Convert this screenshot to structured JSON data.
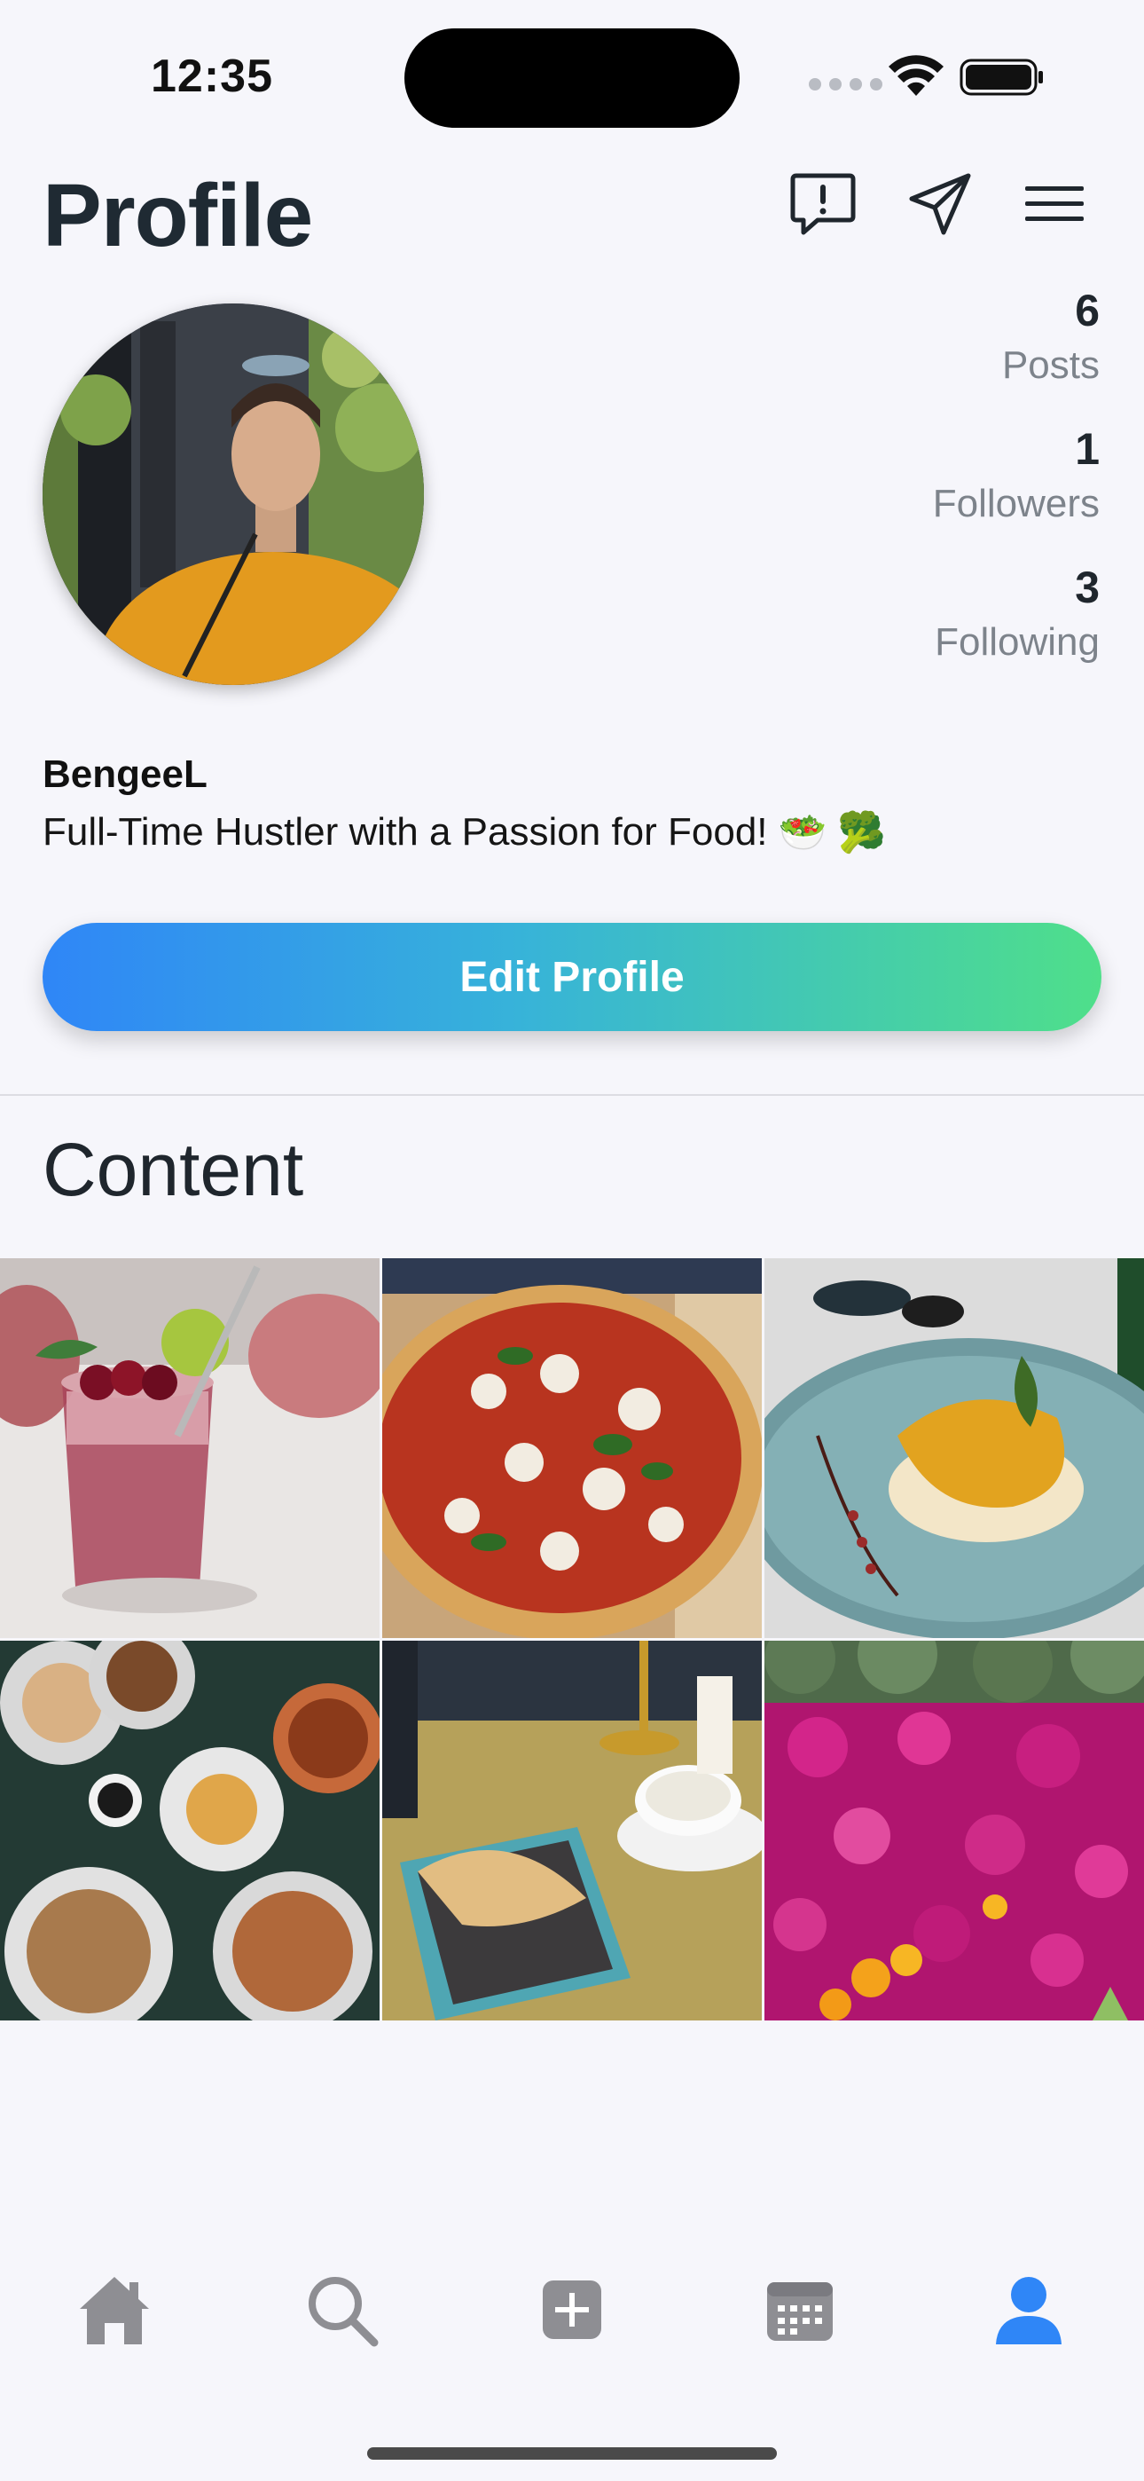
{
  "status_bar": {
    "time": "12:35"
  },
  "header": {
    "title": "Profile",
    "icons": [
      "report-icon",
      "send-icon",
      "menu-icon"
    ]
  },
  "profile": {
    "username": "BengeeL",
    "bio": "Full-Time Hustler with a Passion for Food!",
    "bio_emojis": [
      "🥗",
      "🥦"
    ],
    "stats": [
      {
        "value": "6",
        "label": "Posts"
      },
      {
        "value": "1",
        "label": "Followers"
      },
      {
        "value": "3",
        "label": "Following"
      }
    ],
    "edit_button": "Edit Profile"
  },
  "content": {
    "title": "Content",
    "posts": [
      "cocktail",
      "pizza",
      "plated-dish",
      "brunch-spread",
      "croissant-coffee",
      "pink-flowers"
    ]
  },
  "tab_bar": {
    "items": [
      "home-icon",
      "search-icon",
      "add-icon",
      "calendar-icon",
      "profile-icon"
    ],
    "active": "profile-icon"
  },
  "colors": {
    "accent": "#2f86f7",
    "gradient_end": "#4fdf8a",
    "tab_inactive": "#8e8e93",
    "background": "#f6f6fb"
  }
}
